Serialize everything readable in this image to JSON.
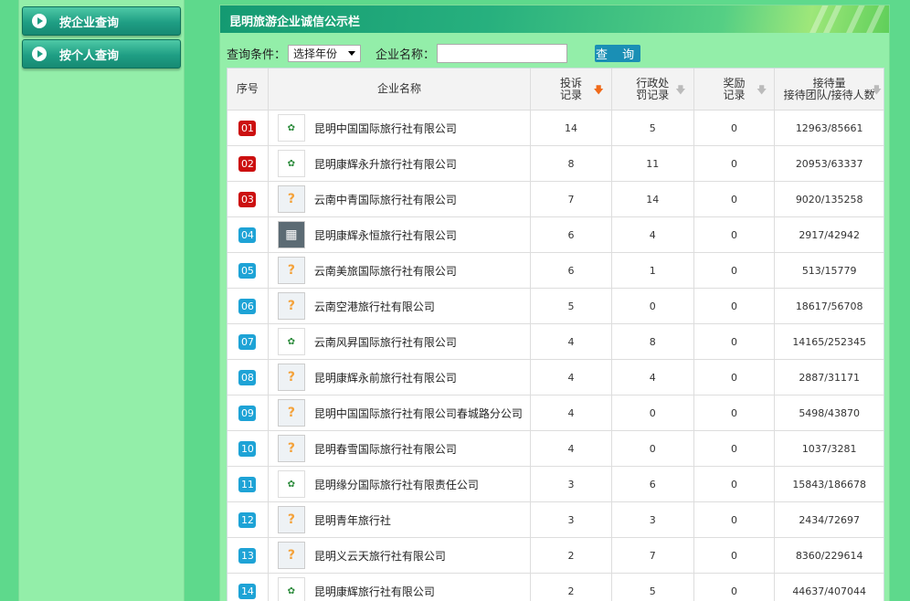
{
  "sidebar": {
    "buttons": [
      {
        "label": "按企业查询"
      },
      {
        "label": "按个人查询"
      }
    ]
  },
  "banner": {
    "title": "昆明旅游企业诚信公示栏"
  },
  "search": {
    "condition_label": "查询条件：",
    "year_select": "选择年份",
    "name_label": "企业名称：",
    "name_value": "",
    "query_button": "查 询"
  },
  "table": {
    "headers": {
      "no": "序号",
      "name": "企业名称",
      "complaints": [
        "投诉",
        "记录"
      ],
      "admin": [
        "行政处",
        "罚记录"
      ],
      "rewards": [
        "奖励",
        "记录"
      ],
      "reception": [
        "接待量",
        "接待团队/接待人数"
      ]
    },
    "rows": [
      {
        "no": "01",
        "badge": "red",
        "logo": "img",
        "name": "昆明中国国际旅行社有限公司",
        "complaints": "14",
        "admin": "5",
        "rewards": "0",
        "reception": "12963/85661"
      },
      {
        "no": "02",
        "badge": "red",
        "logo": "img",
        "name": "昆明康辉永升旅行社有限公司",
        "complaints": "8",
        "admin": "11",
        "rewards": "0",
        "reception": "20953/63337"
      },
      {
        "no": "03",
        "badge": "red",
        "logo": "placeholder",
        "name": "云南中青国际旅行社有限公司",
        "complaints": "7",
        "admin": "14",
        "rewards": "0",
        "reception": "9020/135258"
      },
      {
        "no": "04",
        "badge": "blue",
        "logo": "photo",
        "name": "昆明康辉永恒旅行社有限公司",
        "complaints": "6",
        "admin": "4",
        "rewards": "0",
        "reception": "2917/42942"
      },
      {
        "no": "05",
        "badge": "blue",
        "logo": "placeholder",
        "name": "云南美旅国际旅行社有限公司",
        "complaints": "6",
        "admin": "1",
        "rewards": "0",
        "reception": "513/15779"
      },
      {
        "no": "06",
        "badge": "blue",
        "logo": "placeholder",
        "name": "云南空港旅行社有限公司",
        "complaints": "5",
        "admin": "0",
        "rewards": "0",
        "reception": "18617/56708"
      },
      {
        "no": "07",
        "badge": "blue",
        "logo": "img",
        "name": "云南风昇国际旅行社有限公司",
        "complaints": "4",
        "admin": "8",
        "rewards": "0",
        "reception": "14165/252345"
      },
      {
        "no": "08",
        "badge": "blue",
        "logo": "placeholder",
        "name": "昆明康辉永前旅行社有限公司",
        "complaints": "4",
        "admin": "4",
        "rewards": "0",
        "reception": "2887/31171"
      },
      {
        "no": "09",
        "badge": "blue",
        "logo": "placeholder",
        "name": "昆明中国国际旅行社有限公司春城路分公司",
        "complaints": "4",
        "admin": "0",
        "rewards": "0",
        "reception": "5498/43870"
      },
      {
        "no": "10",
        "badge": "blue",
        "logo": "placeholder",
        "name": "昆明春雪国际旅行社有限公司",
        "complaints": "4",
        "admin": "0",
        "rewards": "0",
        "reception": "1037/3281"
      },
      {
        "no": "11",
        "badge": "blue",
        "logo": "img",
        "name": "昆明缘分国际旅行社有限责任公司",
        "complaints": "3",
        "admin": "6",
        "rewards": "0",
        "reception": "15843/186678"
      },
      {
        "no": "12",
        "badge": "blue",
        "logo": "placeholder",
        "name": "昆明青年旅行社",
        "complaints": "3",
        "admin": "3",
        "rewards": "0",
        "reception": "2434/72697"
      },
      {
        "no": "13",
        "badge": "blue",
        "logo": "placeholder",
        "name": "昆明义云天旅行社有限公司",
        "complaints": "2",
        "admin": "7",
        "rewards": "0",
        "reception": "8360/229614"
      },
      {
        "no": "14",
        "badge": "blue",
        "logo": "img",
        "name": "昆明康辉旅行社有限公司",
        "complaints": "2",
        "admin": "5",
        "rewards": "0",
        "reception": "44637/407044"
      }
    ]
  },
  "colors": {
    "page_bg": "#5ed98c",
    "panel_bg": "#93eea9",
    "red_badge": "#cc1010",
    "blue_badge": "#1ea3d6",
    "query_button": "#1a8fb5",
    "active_sort": "#f06a1a"
  },
  "icons": {
    "sidebar_button": "play-circle-icon",
    "sort_active": "arrow-down-orange-icon",
    "sort_inactive": "arrow-down-gray-icon",
    "logo_placeholder": "question-mark-building-icon"
  }
}
